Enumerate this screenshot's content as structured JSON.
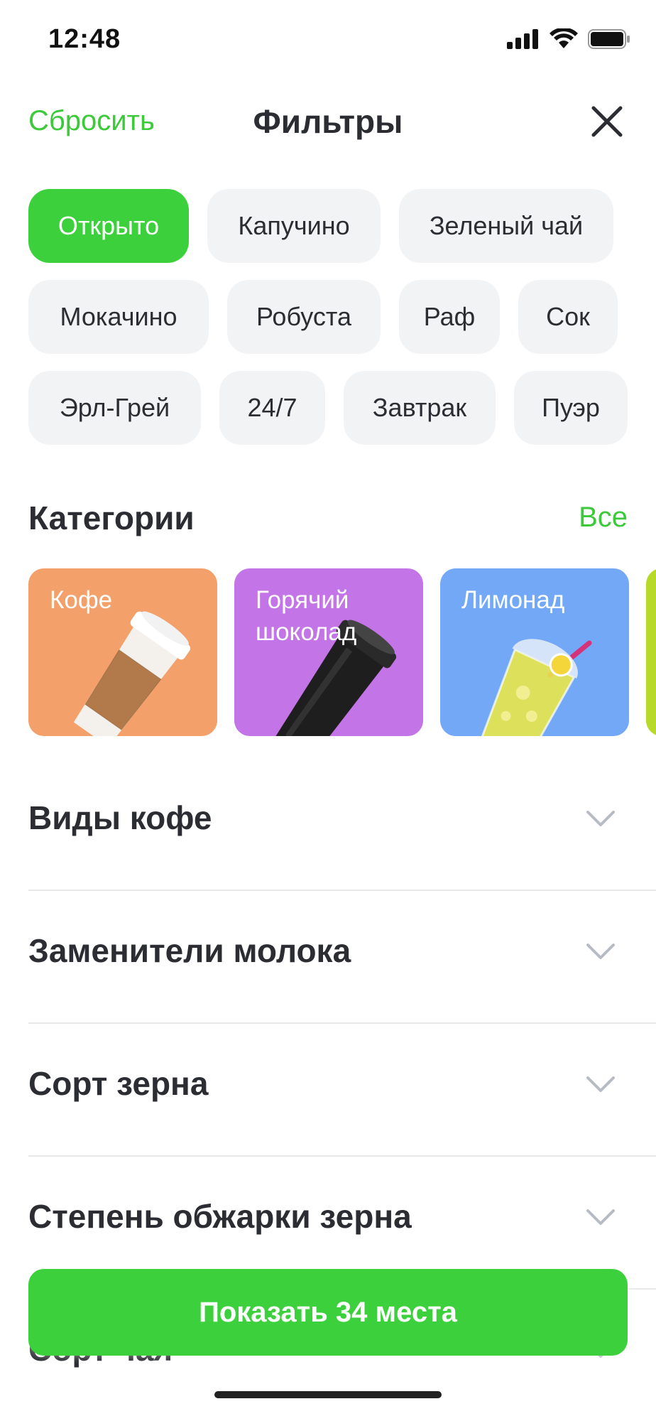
{
  "status_bar": {
    "time": "12:48"
  },
  "header": {
    "reset_label": "Сбросить",
    "title": "Фильтры"
  },
  "chips": [
    [
      {
        "label": "Открыто",
        "active": true
      },
      {
        "label": "Капучино",
        "active": false
      },
      {
        "label": "Зеленый чай",
        "active": false
      }
    ],
    [
      {
        "label": "Мокачино",
        "active": false
      },
      {
        "label": "Робуста",
        "active": false
      },
      {
        "label": "Раф",
        "active": false
      },
      {
        "label": "Сок",
        "active": false
      }
    ],
    [
      {
        "label": "Эрл-Грей",
        "active": false
      },
      {
        "label": "24/7",
        "active": false
      },
      {
        "label": "Завтрак",
        "active": false
      },
      {
        "label": "Пуэр",
        "active": false
      }
    ]
  ],
  "categories": {
    "title": "Категории",
    "all_label": "Все",
    "items": [
      {
        "label": "Кофе",
        "color": "#f3a06a"
      },
      {
        "label": "Горячий шоколад",
        "color": "#c374e6"
      },
      {
        "label": "Лимонад",
        "color": "#73a8f6"
      },
      {
        "label": "",
        "color": "#b6d92a"
      }
    ]
  },
  "filters": [
    {
      "label": "Виды кофе"
    },
    {
      "label": "Заменители молока"
    },
    {
      "label": "Сорт зерна"
    },
    {
      "label": "Степень обжарки зерна"
    },
    {
      "label": "Сорт чая"
    }
  ],
  "show_button": {
    "label": "Показать 34 места"
  },
  "colors": {
    "accent": "#3cd13c",
    "link": "#3cc93a",
    "chip_bg": "#f2f3f5"
  }
}
